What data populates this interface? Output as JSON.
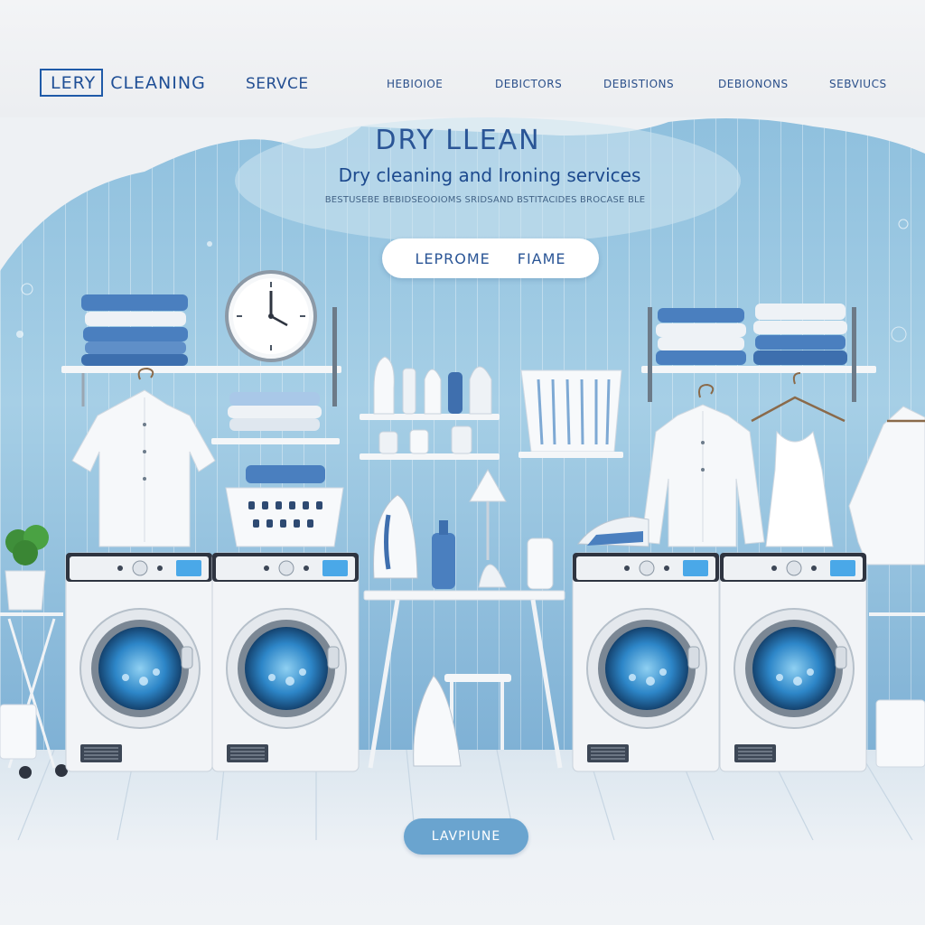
{
  "header": {
    "logo_boxed": "LERY",
    "logo_text": "CLEANING",
    "nav": [
      {
        "label": "SERVCE"
      },
      {
        "label": "HEBIOIOE"
      },
      {
        "label": "DEBICTORS"
      },
      {
        "label": "DEBISTIONS"
      },
      {
        "label": "DEBIONONS"
      },
      {
        "label": "SEBVIUCS"
      }
    ]
  },
  "hero": {
    "title": "DRY LLEAN",
    "subtitle": "Dry cleaning and Ironing services",
    "tagline": "BESTUSEBE BEBIDSEOOIOMS SRIDSAND BSTITACIDES BROCASE BLE",
    "cta_left": "LEPROME",
    "cta_right": "FIAME"
  },
  "footer_button": "LAVPIUNE",
  "colors": {
    "wall": "#a9d0e6",
    "wall_dark": "#7fb3d6",
    "brand": "#1f5aa8",
    "button": "#6aa4cf",
    "machine_body": "#f2f4f7",
    "machine_panel": "#2e3440",
    "display": "#4aa8e8",
    "towel_blue": "#4a7fbf",
    "towel_light": "#e8eef5"
  },
  "icons": [
    "wall-clock-icon",
    "washing-machine-icon",
    "iron-icon",
    "hanger-icon",
    "laundry-basket-icon",
    "plant-icon",
    "bottle-icon",
    "lamp-icon"
  ]
}
